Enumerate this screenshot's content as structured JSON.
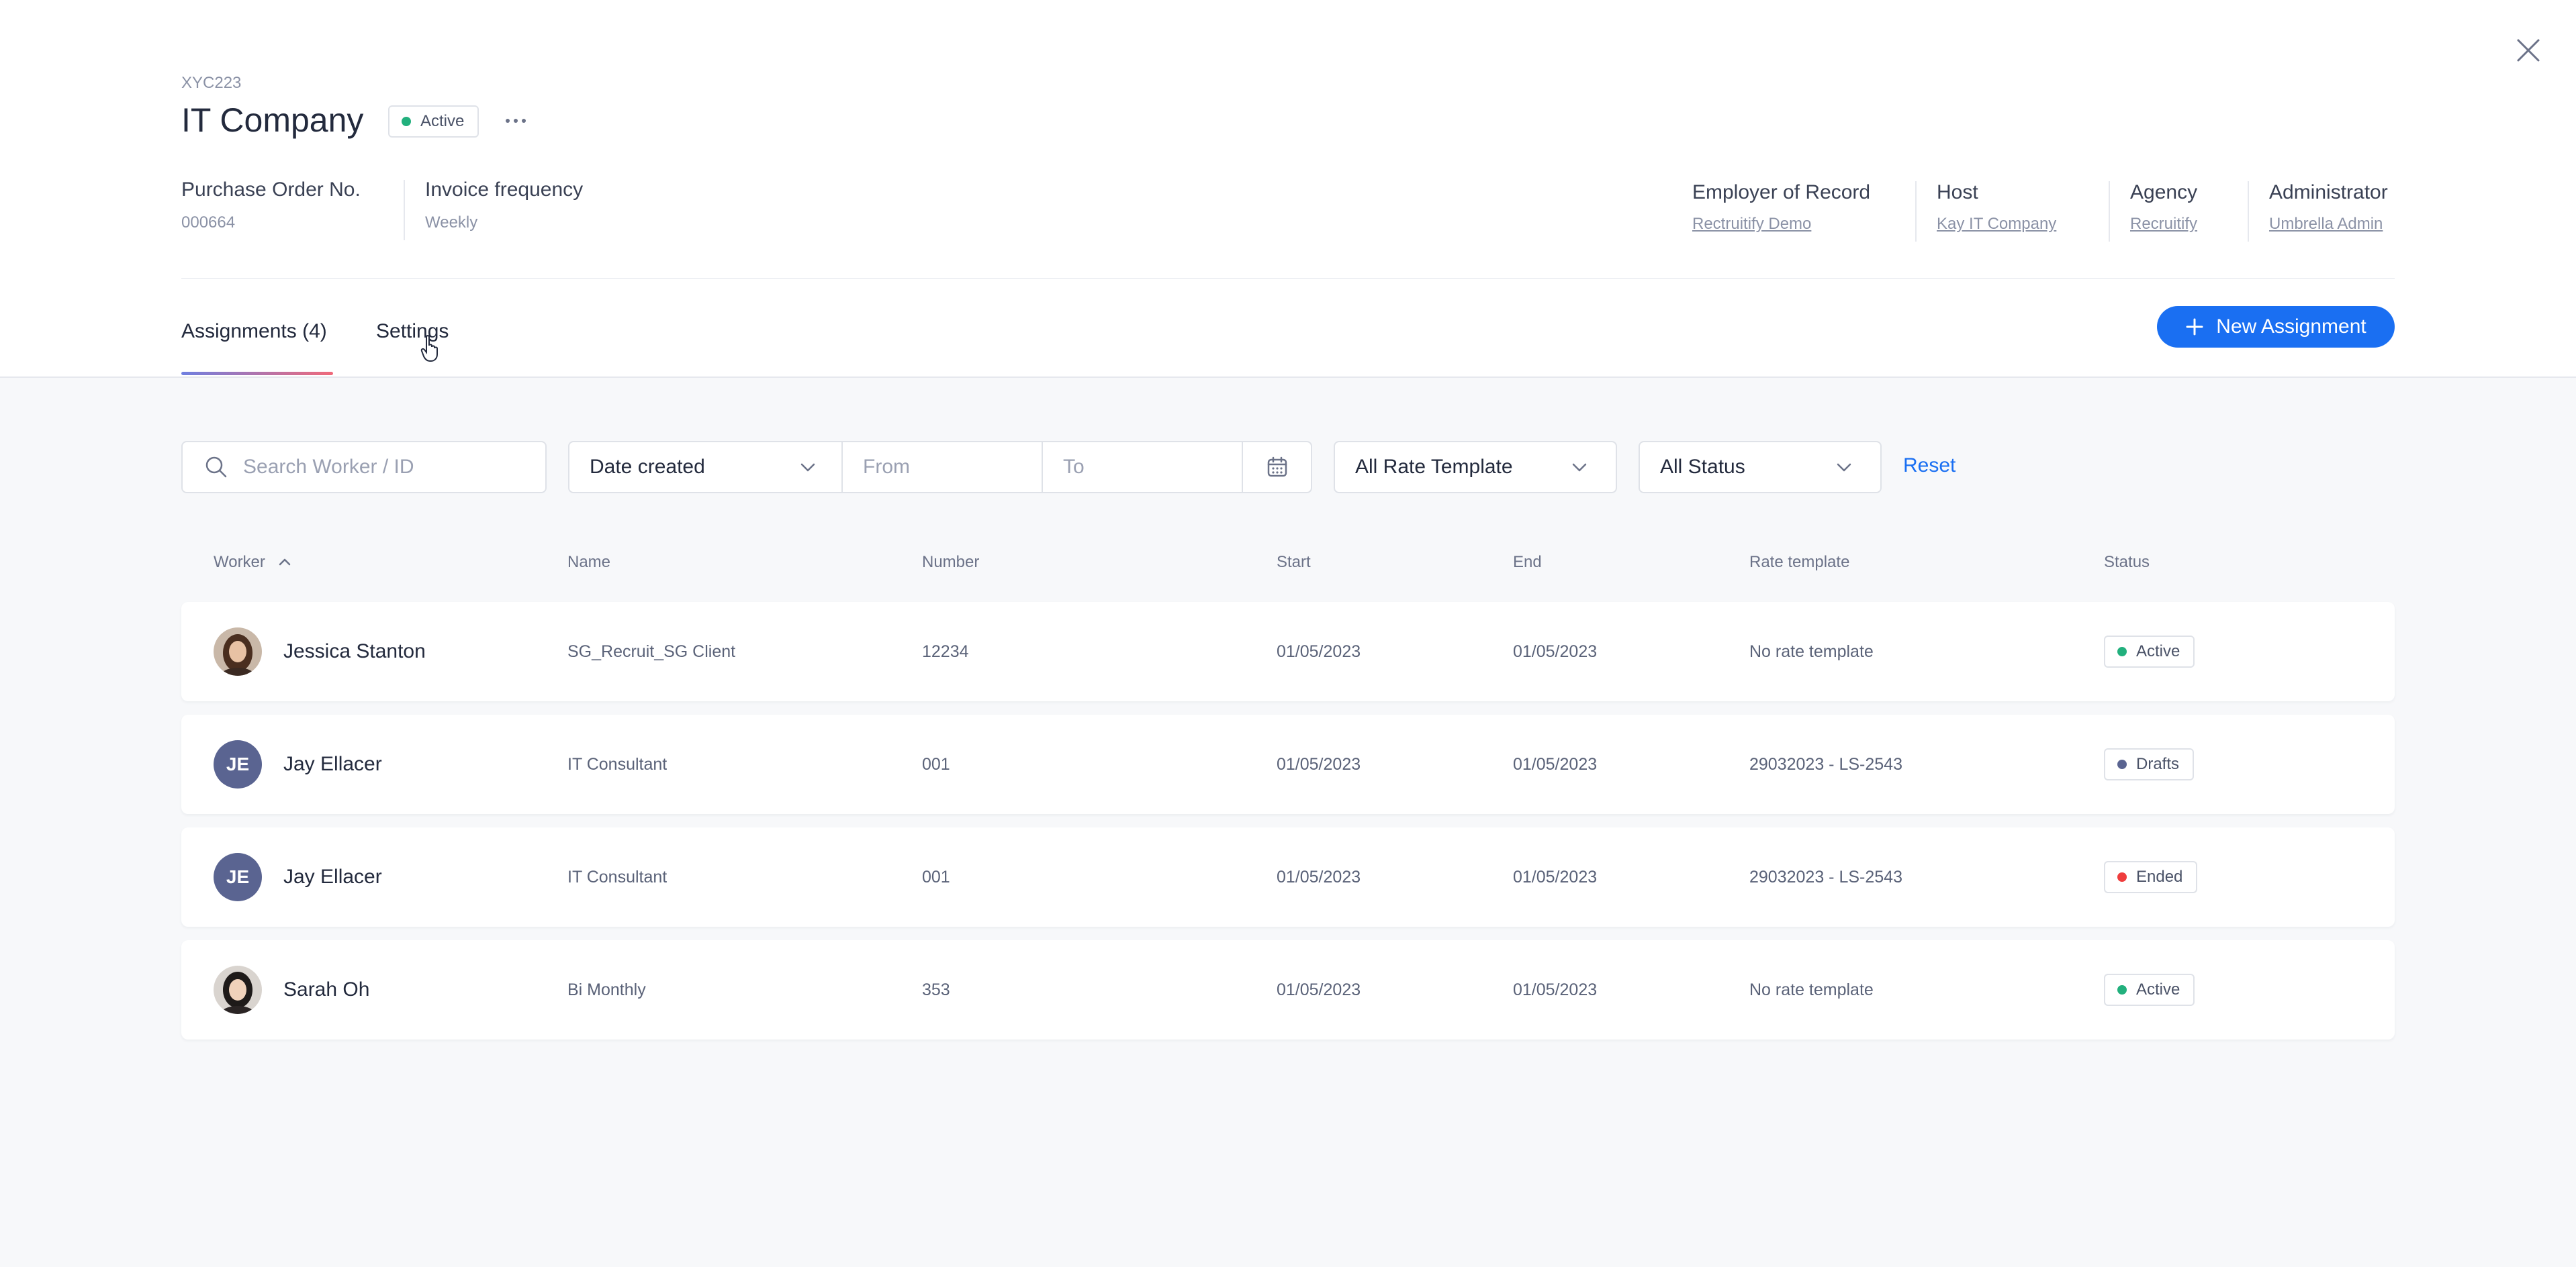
{
  "header": {
    "code": "XYC223",
    "title": "IT Company",
    "status": {
      "label": "Active",
      "color": "#22b07d"
    },
    "more_icon": "ellipsis-icon",
    "close_icon": "close-icon"
  },
  "meta_left": [
    {
      "label": "Purchase Order No.",
      "value": "000664"
    },
    {
      "label": "Invoice frequency",
      "value": "Weekly"
    }
  ],
  "meta_right": [
    {
      "label": "Employer of Record",
      "value": "Rectruitify Demo"
    },
    {
      "label": "Host",
      "value": "Kay IT Company"
    },
    {
      "label": "Agency",
      "value": "Recruitify"
    },
    {
      "label": "Administrator",
      "value": "Umbrella Admin"
    }
  ],
  "tabs": [
    {
      "label": "Assignments (4)",
      "active": true
    },
    {
      "label": "Settings",
      "active": false
    }
  ],
  "new_assignment_label": "New Assignment",
  "filters": {
    "search_placeholder": "Search Worker / ID",
    "date_type": "Date created",
    "from_placeholder": "From",
    "to_placeholder": "To",
    "rate_template": "All Rate Template",
    "status": "All Status",
    "reset_label": "Reset"
  },
  "table": {
    "columns": [
      "Worker",
      "Name",
      "Number",
      "Start",
      "End",
      "Rate template",
      "Status"
    ],
    "sort_column": "Worker",
    "sort_direction": "ascending",
    "rows": [
      {
        "worker": "Jessica Stanton",
        "avatar": "photo",
        "initials": "",
        "name": "SG_Recruit_SG Client",
        "number": "12234",
        "start": "01/05/2023",
        "end": "01/05/2023",
        "rate_template": "No rate template",
        "status": "Active",
        "status_color": "#22b07d"
      },
      {
        "worker": "Jay Ellacer",
        "avatar": "initials",
        "initials": "JE",
        "name": "IT Consultant",
        "number": "001",
        "start": "01/05/2023",
        "end": "01/05/2023",
        "rate_template": "29032023 - LS-2543",
        "status": "Drafts",
        "status_color": "#5a6491"
      },
      {
        "worker": "Jay Ellacer",
        "avatar": "initials",
        "initials": "JE",
        "name": "IT Consultant",
        "number": "001",
        "start": "01/05/2023",
        "end": "01/05/2023",
        "rate_template": "29032023 - LS-2543",
        "status": "Ended",
        "status_color": "#ef3d3d"
      },
      {
        "worker": "Sarah Oh",
        "avatar": "photo",
        "initials": "",
        "name": "Bi Monthly",
        "number": "353",
        "start": "01/05/2023",
        "end": "01/05/2023",
        "rate_template": "No rate template",
        "status": "Active",
        "status_color": "#22b07d"
      }
    ]
  }
}
